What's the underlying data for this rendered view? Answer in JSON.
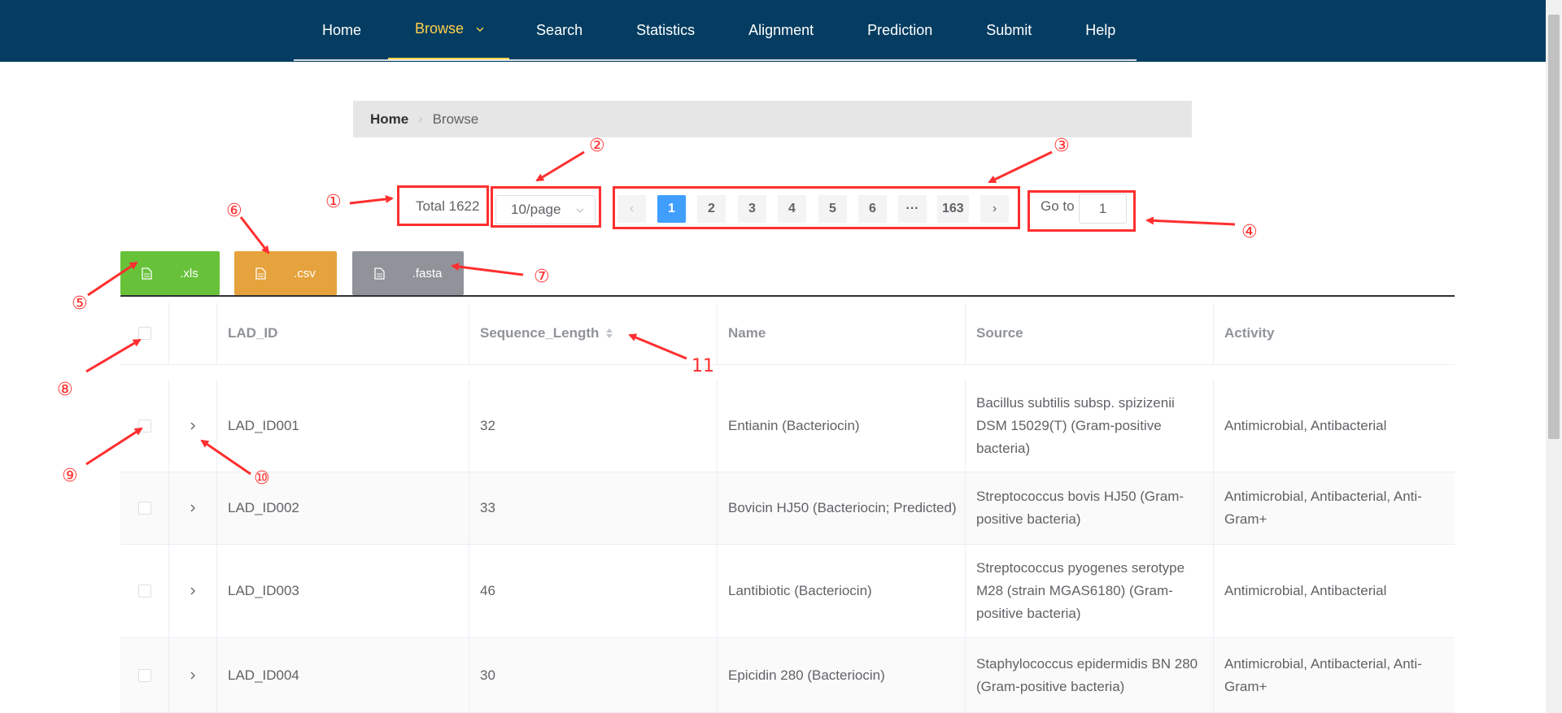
{
  "nav": {
    "items": [
      {
        "label": "Home"
      },
      {
        "label": "Browse"
      },
      {
        "label": "Search"
      },
      {
        "label": "Statistics"
      },
      {
        "label": "Alignment"
      },
      {
        "label": "Prediction"
      },
      {
        "label": "Submit"
      },
      {
        "label": "Help"
      }
    ],
    "active": "Browse"
  },
  "breadcrumb": {
    "home": "Home",
    "current": "Browse"
  },
  "pagination": {
    "total": "Total 1622",
    "page_size": "10/page",
    "prev": "‹",
    "pages": [
      "1",
      "2",
      "3",
      "4",
      "5",
      "6",
      "···",
      "163"
    ],
    "current_page": "1",
    "next": "›",
    "goto_label": "Go to",
    "goto_value": "1"
  },
  "downloads": {
    "xls": ".xls",
    "csv": ".csv",
    "fasta": ".fasta"
  },
  "table": {
    "headers": {
      "id": "LAD_ID",
      "length": "Sequence_Length",
      "name": "Name",
      "source": "Source",
      "activity": "Activity"
    },
    "rows": [
      {
        "id": "LAD_ID001",
        "length": "32",
        "name": "Entianin (Bacteriocin)",
        "source": "Bacillus subtilis subsp. spizizenii DSM 15029(T) (Gram-positive bacteria)",
        "activity": "Antimicrobial, Antibacterial"
      },
      {
        "id": "LAD_ID002",
        "length": "33",
        "name": "Bovicin HJ50 (Bacteriocin; Predicted)",
        "source": "Streptococcus bovis HJ50 (Gram-positive bacteria)",
        "activity": "Antimicrobial, Antibacterial, Anti-Gram+"
      },
      {
        "id": "LAD_ID003",
        "length": "46",
        "name": "Lantibiotic (Bacteriocin)",
        "source": "Streptococcus pyogenes serotype M28 (strain MGAS6180) (Gram-positive bacteria)",
        "activity": "Antimicrobial, Antibacterial"
      },
      {
        "id": "LAD_ID004",
        "length": "30",
        "name": "Epicidin 280 (Bacteriocin)",
        "source": "Staphylococcus epidermidis BN 280 (Gram-positive bacteria)",
        "activity": "Antimicrobial, Antibacterial, Anti-Gram+"
      }
    ]
  },
  "annotations": {
    "n1": "①",
    "n2": "②",
    "n3": "③",
    "n4": "④",
    "n5": "⑤",
    "n6": "⑥",
    "n7": "⑦",
    "n8": "⑧",
    "n9": "⑨",
    "n10": "⑩",
    "n11": "11"
  },
  "colors": {
    "nav_bg": "#043d61",
    "nav_active": "#ffd04b",
    "page_active": "#409eff",
    "xls": "#67c23a",
    "csv": "#e6a23c",
    "fasta": "#909399",
    "annotation": "#ff2f2f"
  }
}
